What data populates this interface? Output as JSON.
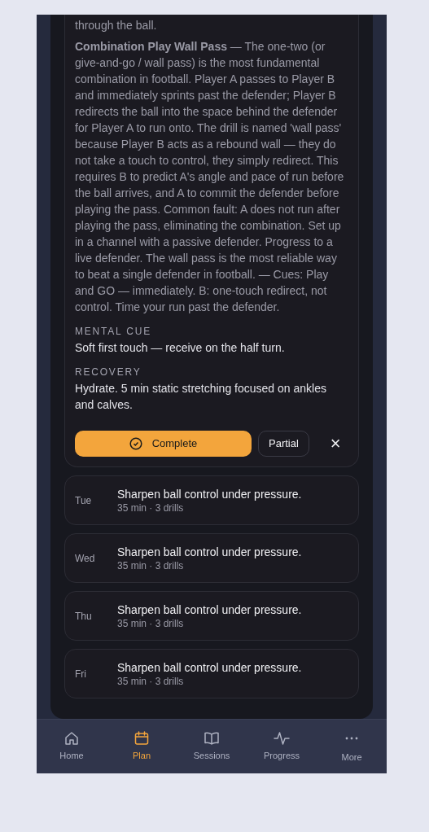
{
  "drill_card": {
    "previous_text_end": "through the ball.",
    "drill_text": "**Combination Play Wall Pass** — The one-two (or give-and-go / wall pass) is the most fundamental combination in football. Player A passes to Player B and immediately sprints past the defender; Player B redirects the ball into the space behind the defender for Player A to run onto. The drill is named 'wall pass' because Player B acts as a rebound wall — they do not take a touch to control, they simply redirect. This requires B to predict A's angle and pace of run before the ball arrives, and A to commit the defender before playing the pass. Common fault: A does not run after playing the pass, eliminating the combination. Set up in a channel with a passive defender. Progress to a live defender. The wall pass is the most reliable way to beat a single defender in football. — Cues: Play and GO — immediately. B: one-touch redirect, not control. Time your run past the defender.",
    "sections": [
      {
        "label": "MENTAL CUE",
        "text": "Soft first touch — receive on the half turn."
      },
      {
        "label": "RECOVERY",
        "text": "Hydrate. 5 min static stretching focused on ankles and calves."
      }
    ],
    "actions": {
      "complete": "Complete",
      "partial": "Partial",
      "dismiss": "×"
    }
  },
  "days": [
    {
      "day": "Tue",
      "title": "Sharpen ball control under pressure.",
      "meta": "35 min · 3 drills"
    },
    {
      "day": "Wed",
      "title": "Sharpen ball control under pressure.",
      "meta": "35 min · 3 drills"
    },
    {
      "day": "Thu",
      "title": "Sharpen ball control under pressure.",
      "meta": "35 min · 3 drills"
    },
    {
      "day": "Fri",
      "title": "Sharpen ball control under pressure.",
      "meta": "35 min · 3 drills"
    }
  ],
  "nav": [
    {
      "label": "Home",
      "selected": false
    },
    {
      "label": "Plan",
      "selected": true
    },
    {
      "label": "Sessions",
      "selected": false
    },
    {
      "label": "Progress",
      "selected": false
    },
    {
      "label": "More",
      "selected": false
    }
  ]
}
